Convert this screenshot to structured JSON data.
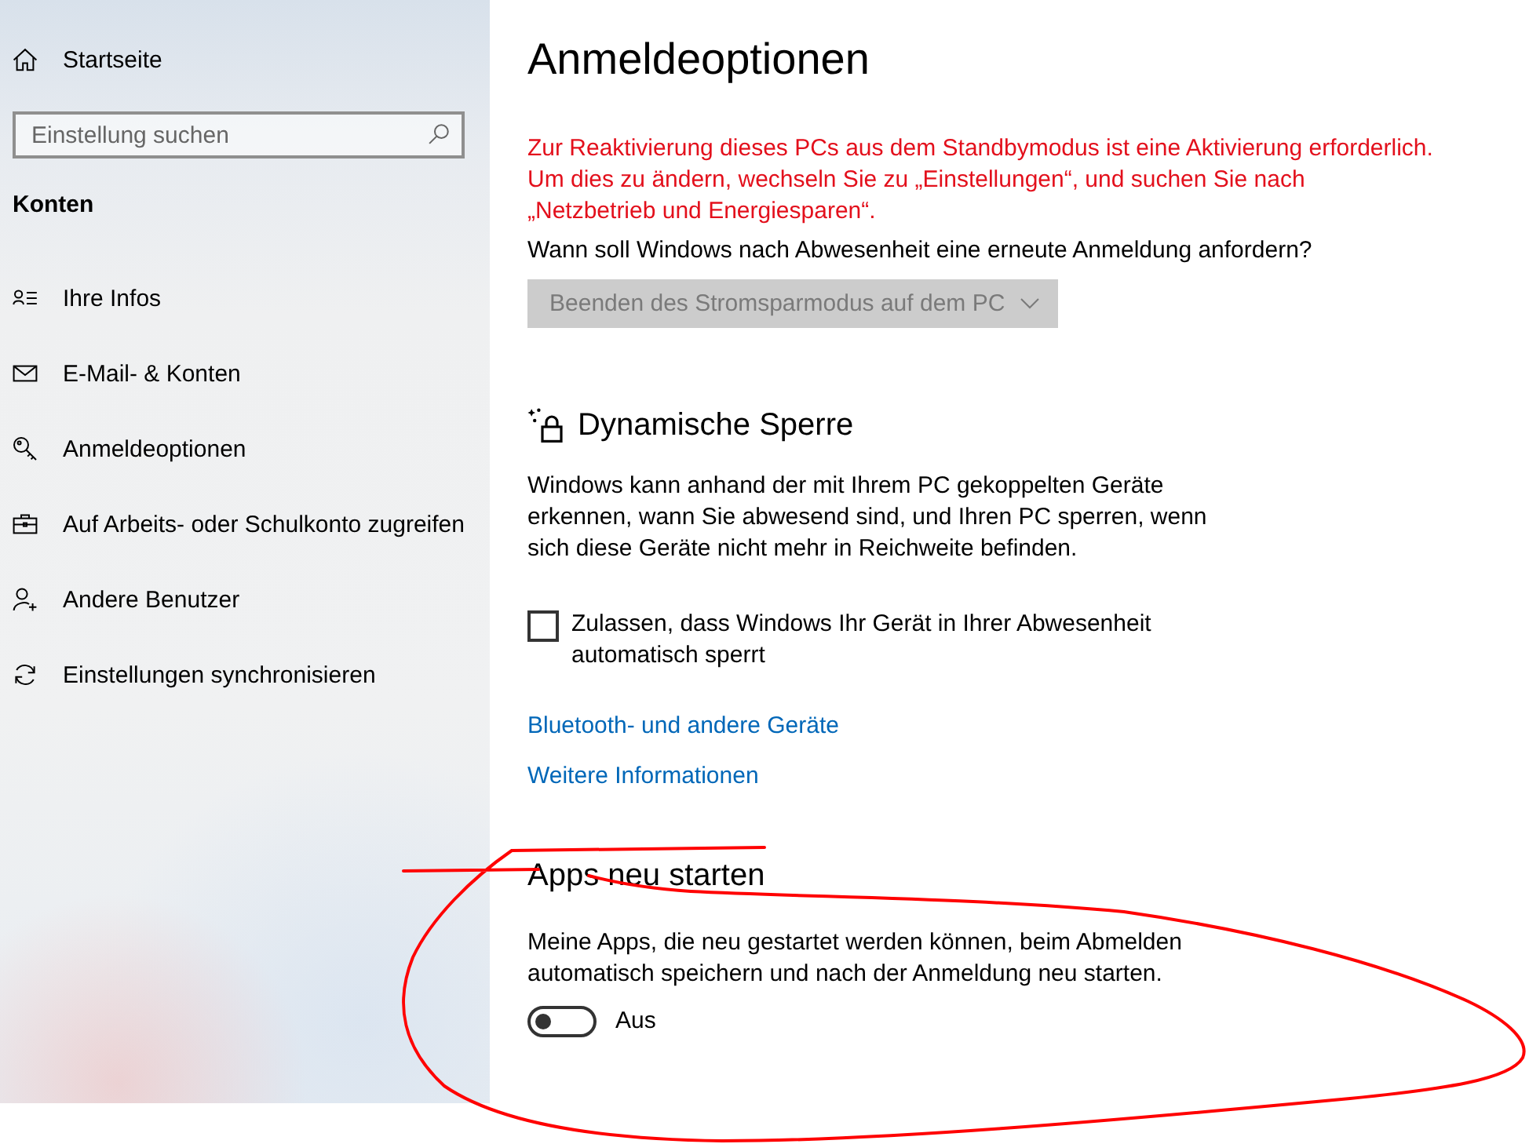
{
  "sidebar": {
    "home": {
      "label": "Startseite"
    },
    "search": {
      "placeholder": "Einstellung suchen"
    },
    "title": "Konten",
    "items": [
      {
        "label": "Ihre Infos"
      },
      {
        "label": "E-Mail- & Konten"
      },
      {
        "label": "Anmeldeoptionen"
      },
      {
        "label": "Auf Arbeits- oder Schulkonto zugreifen"
      },
      {
        "label": "Andere Benutzer"
      },
      {
        "label": "Einstellungen synchronisieren"
      }
    ]
  },
  "main": {
    "title": "Anmeldeoptionen",
    "require_signin": {
      "notice": "Zur Reaktivierung dieses PCs aus dem Standbymodus ist eine Aktivierung erforderlich.\nUm dies zu ändern, wechseln Sie zu „Einstellungen“, und suchen Sie nach\n„Netzbetrieb und Energiesparen“.",
      "question": "Wann soll Windows nach Abwesenheit eine erneute Anmeldung anfordern?",
      "dropdown": {
        "value": "Beenden des Stromsparmodus auf dem PC",
        "disabled": true
      }
    },
    "dynamic_lock": {
      "heading": "Dynamische Sperre",
      "description": "Windows kann anhand der mit Ihrem PC gekoppelten Geräte\nerkennen, wann Sie abwesend sind, und Ihren PC sperren, wenn\nsich diese Geräte nicht mehr in Reichweite befinden.",
      "checkbox": {
        "label": "Zulassen, dass Windows Ihr Gerät in Ihrer Abwesenheit\nautomatisch sperrt",
        "checked": false
      },
      "links": [
        "Bluetooth- und andere Geräte",
        "Weitere Informationen"
      ]
    },
    "restart_apps": {
      "heading": "Apps neu starten",
      "description": "Meine Apps, die neu gestartet werden können, beim Abmelden\nautomatisch speichern und nach der Anmeldung neu starten.",
      "toggle": {
        "on": false,
        "label": "Aus"
      }
    }
  },
  "annotations": [
    {
      "kind": "loop"
    }
  ]
}
